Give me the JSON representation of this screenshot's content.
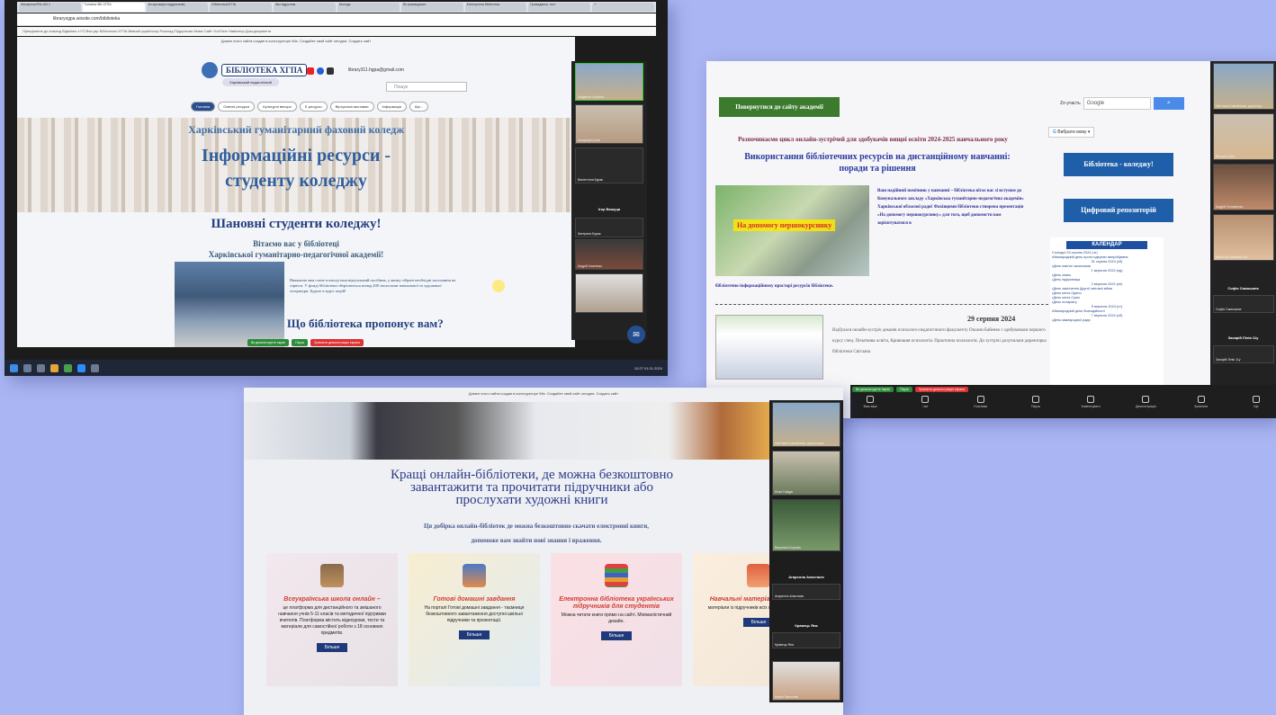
{
  "shot1": {
    "tabs": [
      "Wordpress/PM-100 1",
      "Головна /ВК-ХГПА",
      "Кн.зірочки(ст.підручників)",
      "Бібліотека/ХГПА",
      "Вікі підручник",
      "Молодь",
      "Як розміщувати",
      "Електронна бібліотека",
      "Громадянсь. тест",
      "+"
    ],
    "url": "libraryxgpa.wixsite.com/biblioteka",
    "bookmarks": "Приєднання до команд   Відмінно з ГО   Вчи.укр   Бібліотека-ХГПА   Вивчай українську   Розклад   Підручники   Мова   Сайт   YouTube   Навігатор   Дом.документи",
    "notice": "Домен этого сайта создан в конструкторе Wix. Создайте свой сайт сегодня.   Создать сайт",
    "logo_text": "БІБЛІОТЕКА ХГПА",
    "subtitle": "Харківський педагогічний",
    "email": "library311.hgpa@gmail.com",
    "search_placeholder": "Пошук",
    "nav": [
      "Головна",
      "Освітні ресурси",
      "Культурні вечори",
      "Е-ресурси",
      "Віртуальні виставки",
      "Інформація",
      "Ще..."
    ],
    "hero_line1": "Харківський гуманітарний фаховий коледж",
    "hero_line2": "Інформаційні ресурси -",
    "hero_line3": "студенту коледжу",
    "heading": "Шановні студенти коледжу!",
    "greet1": "Вітаємо вас у бібліотеці",
    "greet2": "Харківської гуманітарно-педагогічної академії!",
    "para": "Вважаємо вам стане в нагоді наш віртуальний посібник, у якому зібрані необхідні посилання на сервіси. У фонді бібліотеки зберігаються понад 200 тисяч книг навчальної та художньої літератури. Будьте в курсі подій!",
    "question": "Що бібліотека пропонує вам?",
    "chat_icon": "chat-bubble-icon",
    "zoom_bar": [
      "Ви демонструєте екран",
      "Пауза",
      "Зупинити демонстрацію екрана"
    ],
    "participants": [
      "Людмила Єрохіна",
      "Асоціація учнів",
      "Валентина Бурак",
      "Ігор Вашуца",
      "Катерина Бурак",
      "Андрій Ігнатенко",
      ""
    ],
    "clock": "10:27 01.01.2024",
    "colors": {
      "brand": "#2a4d8f",
      "hero_text": "#2f5f9d",
      "accent_green": "#2e8b3a",
      "accent_red": "#d33"
    }
  },
  "shot2": {
    "back_button": "Повернутися до сайту академії",
    "search_label": "Zo-участь",
    "search_value": "Google",
    "lang_select": "Вибрати мову",
    "side_buttons": [
      "Бібліотека - коледжу!",
      "Цифровий репозиторій"
    ],
    "headline": "Розпочинаємо цикл онлайн-зустрічей для здобувачів вищої освіти 2024-2025 навчального року",
    "title": "Використання бібліотечних ресурсів на дистанційному навчанні: поради та рішення",
    "image_caption": "На допомогу першокурснику",
    "intro": "Ваш надійний помічник у навчанні – бібліотека вітає вас зі вступом до Комунального закладу «Харківська гуманітарно-педагогічна академія» Харківської обласної ради! Фахівцями бібліотеки створена презентація «На допомогу першокурснику» для того, щоб допомогти вам зорієнтуватися в",
    "intro_end": "бібліотечно-інформаційному просторі ресурсів бібліотеки.",
    "date": "29 серпня 2024",
    "news": "Відбулася онлайн-зустріч деканів психолого-педагогічного факультету Оксани Бабенко з здобувачами першого курсу спец. Початкова освіта, Кривошия психологія. Практична психологія. До зустрічі долучилася директорка бібліотеки Світлана",
    "calendar_title": "КАЛЕНДАР",
    "calendar_lines": [
      "Сьогодні 29 серпня 2024 (чт)",
      "•Міжнародний день проти ядерних випробувань",
      "31 серпня 2024 (сб)",
      "•День пам'яті захисників",
      "1 вересня 2024 (нд)",
      "•День знань",
      "•День підприємця",
      "2 вересня 2024 (пн)",
      "•День закінчення Другої світової війни",
      "•День міста Одеси",
      "•День міста Суми",
      "•День нотаріату",
      "5 вересня 2024 (чт)",
      "•Міжнародний день благодійності",
      "7 вересня 2024 (сб)",
      "•День міжнародної ради"
    ],
    "zoom_bar": [
      "Ви демонструєте екран",
      "Пауза",
      "Зупинити демонстрацію екрана"
    ],
    "zoom_controls": [
      "Ваш звук",
      "Чат",
      "Учасники",
      "Пауза",
      "Коментувати",
      "Демонстрація",
      "Зупинити",
      "Ще"
    ],
    "participants": [
      "Світлана Самойлова, директор",
      "Вікторія Грин",
      "Андрій Гонтаренко",
      "Віолетта Хоменко 118",
      "Софія Самошина",
      "Софія Самошина",
      "Захарій Лілія 11у",
      "Захарій Лілія 11у"
    ]
  },
  "shot3": {
    "notice": "Домен этого сайта создан в конструкторе Wix. Создайте свой сайт сегодня.   Создать сайт",
    "title": "Кращі онлайн-бібліотеки, де можна безкоштовно завантажити та прочитати підручники або прослухати художні книги",
    "lead": "Ця добірка онлайн-бібліотек де можна безкоштовно скачати електронні книги, допоможе вам знайти нові знання і враження.",
    "cards": [
      {
        "title": "Всеукраїнська школа онлайн –",
        "desc": "це платформа для дистанційного та змішаного навчання учнів 5-11 класів та методичної підтримки вчителів. Платформа містить відеоуроки, тести та матеріали для самостійної роботи з 18 основних предметів.",
        "btn": "Більше"
      },
      {
        "title": "Готові домашні завдання",
        "desc": "На порталі Готові домашні завдання - таємниця безкоштовного завантаження доступні шкільні підручники та презентації.",
        "btn": "Більше"
      },
      {
        "title": "Електронна бібліотека українських підручників для студентів",
        "desc": "Можна читати книги прямо на сайті. Мінімалістичний дизайн.",
        "btn": "Більше"
      },
      {
        "title": "Навчальні матеріали онлайн –",
        "desc": "матеріали із підручників всіх напрямів навчання.",
        "btn": "Більше"
      }
    ],
    "participants": [
      "Світлана Самойлова, директорка",
      "Юлія Гайдук",
      "Вероніка Єгорова",
      "Агарелла Анастасія",
      "Агарелла Анастасія",
      "Кравець Яна",
      "Кравець Яна",
      "Марія Тарасова"
    ]
  }
}
